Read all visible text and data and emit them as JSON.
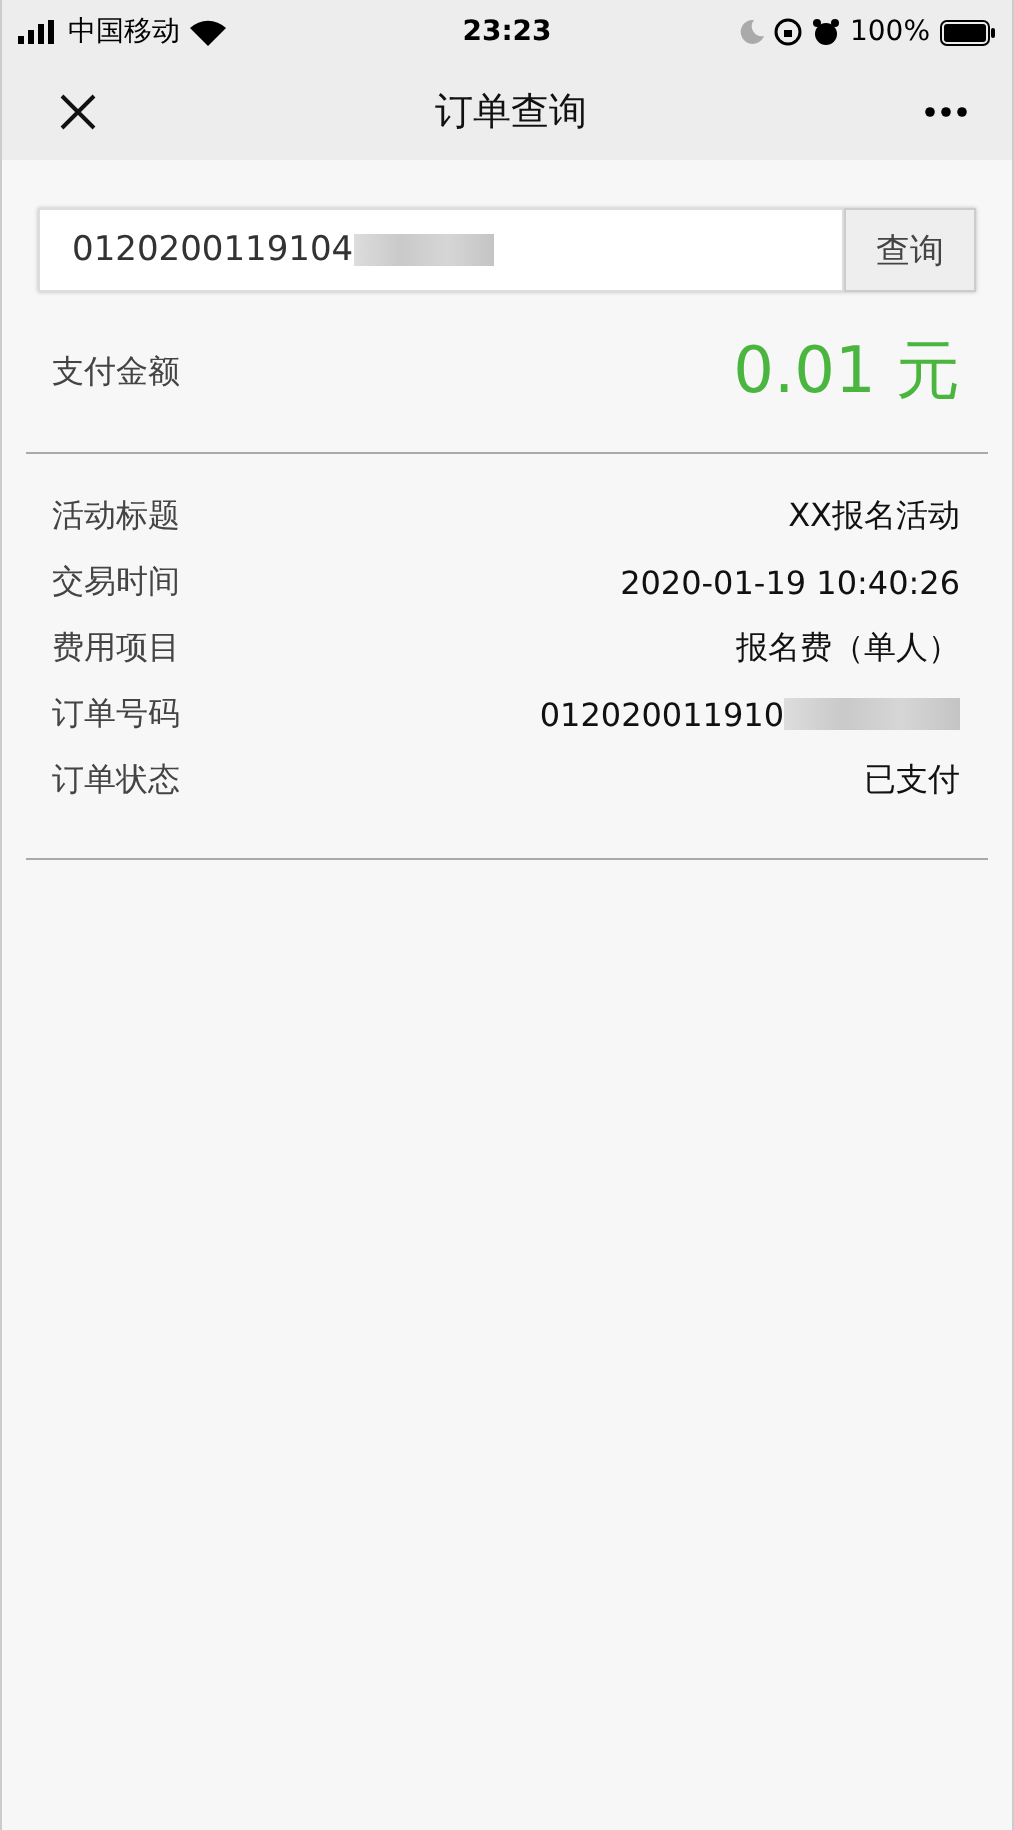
{
  "status_bar": {
    "carrier": "中国移动",
    "time": "23:23",
    "battery": "100%"
  },
  "nav": {
    "title": "订单查询"
  },
  "search": {
    "value": "0120200119104",
    "button": "查询"
  },
  "amount": {
    "label": "支付金额",
    "value": "0.01 元"
  },
  "details": [
    {
      "label": "活动标题",
      "value": "XX报名活动",
      "redacted": false
    },
    {
      "label": "交易时间",
      "value": "2020-01-19 10:40:26",
      "redacted": false
    },
    {
      "label": "费用项目",
      "value": "报名费（单人）",
      "redacted": false
    },
    {
      "label": "订单号码",
      "value": "012020011910",
      "redacted": true
    },
    {
      "label": "订单状态",
      "value": "已支付",
      "redacted": false
    }
  ]
}
